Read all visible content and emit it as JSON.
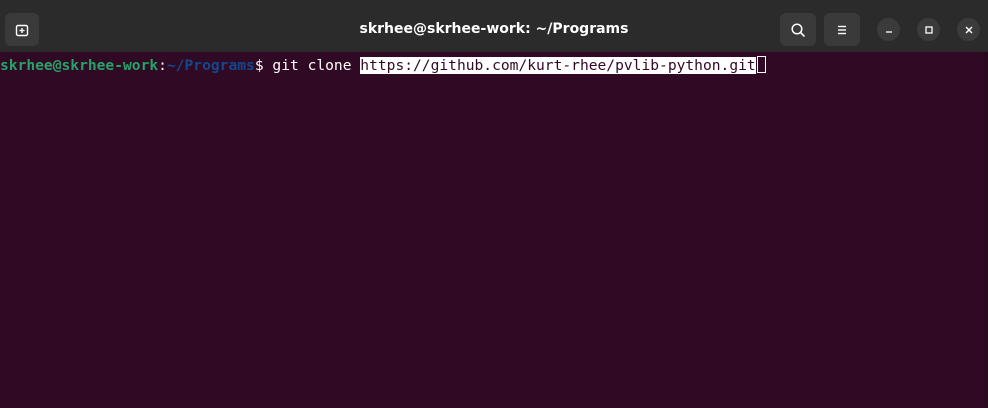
{
  "window": {
    "title": "skrhee@skrhee-work: ~/Programs"
  },
  "titlebar": {
    "icons": {
      "new_tab": "new-tab-icon",
      "search": "search-icon",
      "menu": "hamburger-menu-icon",
      "minimize": "minimize-icon",
      "maximize": "maximize-icon",
      "close": "close-icon"
    }
  },
  "terminal": {
    "prompt": {
      "user_host": "skrhee@skrhee-work",
      "colon": ":",
      "path": "~/Programs",
      "dollar": "$"
    },
    "command": "git clone",
    "selected_text": "https://github.com/kurt-rhee/pvlib-python.git"
  },
  "colors": {
    "terminal_bg": "#300a24",
    "titlebar_bg": "#2b2b2b",
    "prompt_user": "#26a269",
    "prompt_path": "#12488b",
    "text": "#ffffff"
  }
}
